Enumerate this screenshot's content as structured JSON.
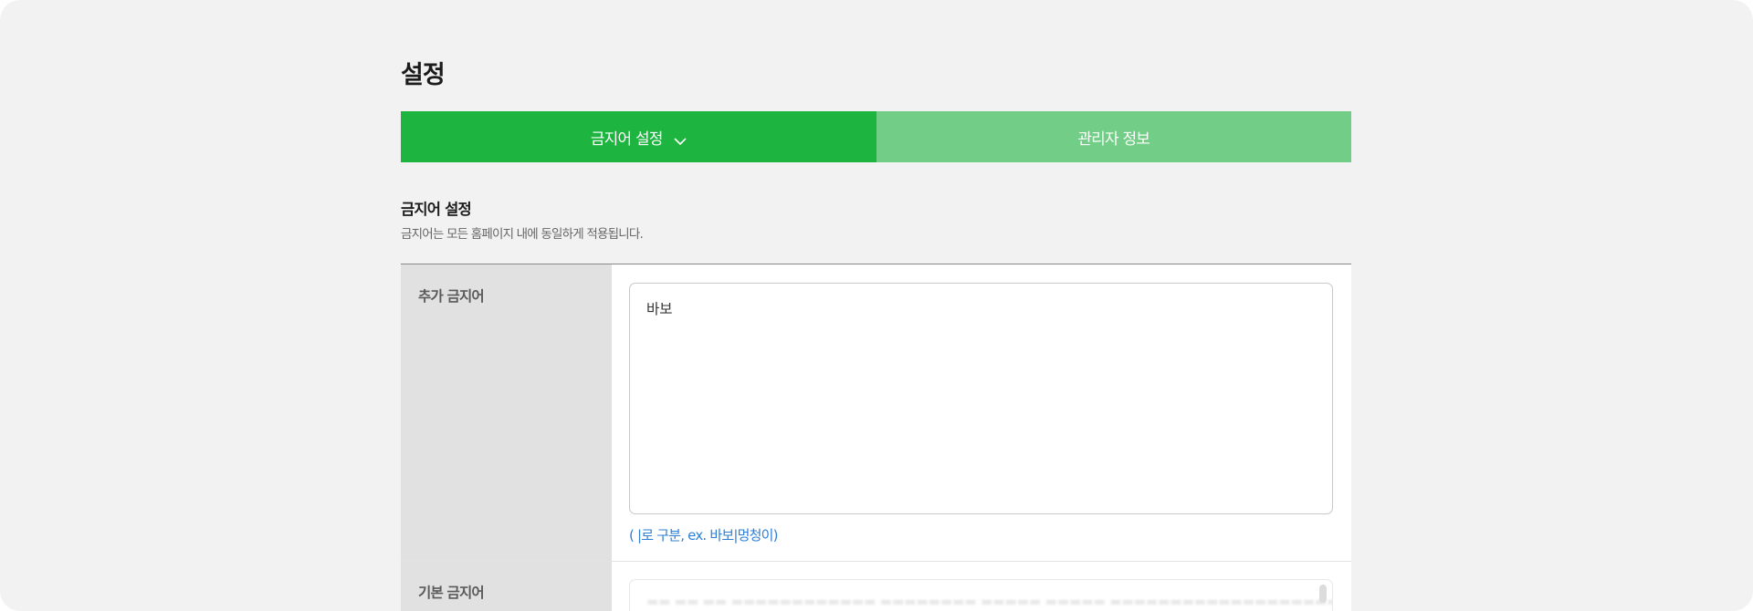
{
  "page": {
    "title": "설정"
  },
  "tabs": [
    {
      "label": "금지어 설정",
      "active": true,
      "icon": "chevron-down-icon"
    },
    {
      "label": "관리자 정보",
      "active": false
    }
  ],
  "section": {
    "title": "금지어 설정",
    "description": "금지어는 모든 홈페이지 내에 동일하게 적용됩니다."
  },
  "form": {
    "added_words": {
      "label": "추가 금지어",
      "value": "바보",
      "hint": "( |로 구분, ex. 바보|멍청이)"
    },
    "default_words": {
      "label": "기본 금지어"
    }
  },
  "colors": {
    "tab_active": "#1db43f",
    "tab_inactive": "#72cd87",
    "hint": "#2d7fd6",
    "row_header_bg": "#e1e1e1",
    "page_bg": "#f2f2f2"
  }
}
